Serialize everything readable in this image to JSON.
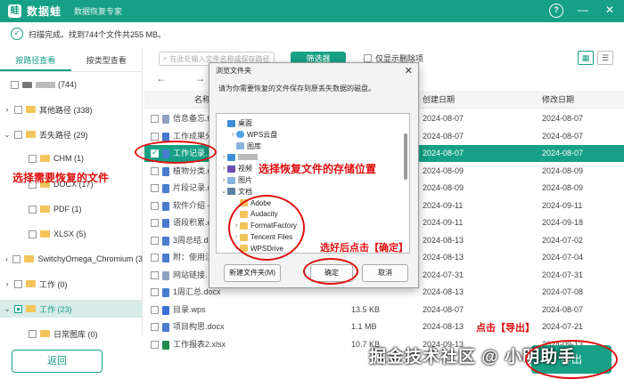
{
  "app": {
    "logo_text": "蛙",
    "name": "数据蛙",
    "subtitle": "数据恢复专家",
    "controls": [
      "?",
      "—",
      "✕"
    ]
  },
  "status": {
    "check": "✓",
    "text": "扫描完成。找到744个文件共255 MB。"
  },
  "left": {
    "tabs": [
      "按路径查看",
      "按类型查看"
    ],
    "tree": [
      {
        "label": "(744)",
        "arrow": "",
        "blur": true
      },
      {
        "label": "其他路径 (338)",
        "arrow": "›"
      },
      {
        "label": "丢失路径 (29)",
        "arrow": "⌄"
      },
      {
        "label": "CHM (1)",
        "arrow": ""
      },
      {
        "label": "DOCX (17)",
        "arrow": ""
      },
      {
        "label": "PDF (1)",
        "arrow": ""
      },
      {
        "label": "XLSX (5)",
        "arrow": ""
      },
      {
        "label": "SwitchyOmega_Chromium (3",
        "arrow": "›"
      },
      {
        "label": "工作 (0)",
        "arrow": "›"
      },
      {
        "label": "工作 (23)",
        "arrow": "⌄"
      },
      {
        "label": "日常图库 (0)",
        "arrow": ""
      }
    ]
  },
  "toolbar": {
    "search_placeholder": "在此处输入文件名称或保存路径",
    "filter_label": "筛选器",
    "only_deleted": "仅显示删除项",
    "nav": "← →"
  },
  "table": {
    "headers": {
      "name": "名称",
      "size": "大小",
      "created": "创建日期",
      "modified": "修改日期"
    },
    "rows": [
      {
        "name": "信息备忘.t",
        "size": "",
        "created": "2024-08-07",
        "modified": "2024-08-07",
        "type": "txt"
      },
      {
        "name": "工作成果分",
        "size": "",
        "created": "2024-08-07",
        "modified": "2024-08-07",
        "type": "doc"
      },
      {
        "name": "工作记录.",
        "size": "",
        "created": "2024-08-07",
        "modified": "2024-08-07",
        "type": "doc",
        "selected": true
      },
      {
        "name": "植物分类.d",
        "size": "",
        "created": "2024-08-09",
        "modified": "2024-08-09",
        "type": "doc"
      },
      {
        "name": "片段记录.d",
        "size": "",
        "created": "2024-08-09",
        "modified": "2024-08-09",
        "type": "doc"
      },
      {
        "name": "软件介绍 -",
        "size": "",
        "created": "2024-09-11",
        "modified": "2024-09-11",
        "type": "doc"
      },
      {
        "name": "语段积累.d",
        "size": "",
        "created": "2024-09-11",
        "modified": "2024-09-18",
        "type": "doc"
      },
      {
        "name": "3周总结.doc",
        "size": "",
        "created": "2024-08-13",
        "modified": "2024-07-02",
        "type": "doc"
      },
      {
        "name": "附：使用注",
        "size": "",
        "created": "2024-08-13",
        "modified": "2024-07-04",
        "type": "doc"
      },
      {
        "name": "网站链接.",
        "size": "",
        "created": "2024-07-31",
        "modified": "2024-07-31",
        "type": "txt"
      },
      {
        "name": "1周汇总.docx",
        "size": "",
        "created": "2024-08-13",
        "modified": "2024-07-08",
        "type": "doc"
      },
      {
        "name": "目录.wps",
        "size": "13.5 KB",
        "created": "2024-08-07",
        "modified": "2024-08-07",
        "type": "wps"
      },
      {
        "name": "项目构思.docx",
        "size": "1.1 MB",
        "created": "2024-08-13",
        "modified": "2024-07-21",
        "type": "doc"
      },
      {
        "name": "工作报表2.xlsx",
        "size": "10.7 KB",
        "created": "2024-09-13",
        "modified": "2024-09-13",
        "type": "xls"
      }
    ]
  },
  "bottom": {
    "back": "返回",
    "export": "导出",
    "watermark": "掘金技术社区 @ 小明助手"
  },
  "dialog": {
    "title": "浏览文件夹",
    "close": "✕",
    "message": "请为你需要恢复的文件保存到原丢失数据的磁盘。",
    "tree": [
      {
        "label": "桌面",
        "icon": "desk",
        "caret": ""
      },
      {
        "label": "WPS云盘",
        "icon": "cloud",
        "caret": "›"
      },
      {
        "label": "图库",
        "icon": "pic",
        "caret": ""
      },
      {
        "label": "",
        "icon": "desk",
        "caret": "›",
        "blur": true
      },
      {
        "label": "视频",
        "icon": "vid",
        "caret": "›"
      },
      {
        "label": "图片",
        "icon": "pic",
        "caret": "›"
      },
      {
        "label": "文档",
        "icon": "doc",
        "caret": "⌄"
      },
      {
        "label": "Adobe",
        "icon": "fold",
        "caret": ""
      },
      {
        "label": "Audacity",
        "icon": "fold",
        "caret": ""
      },
      {
        "label": "FormatFactory",
        "icon": "fold",
        "caret": "›"
      },
      {
        "label": "Tencent Files",
        "icon": "fold",
        "caret": "›"
      },
      {
        "label": "WPSDrive",
        "icon": "fold",
        "caret": "›"
      }
    ],
    "new_folder": "新建文件夹(M)",
    "ok": "确定",
    "cancel": "取消"
  },
  "annotations": {
    "select_files": "选择需要恢复的文件",
    "select_location": "选择恢复文件的存储位置",
    "click_ok": "选好后点击【确定】",
    "click_export": "点击【导出】"
  },
  "colors": {
    "accent": "#16a085",
    "annotation": "#e01010"
  }
}
